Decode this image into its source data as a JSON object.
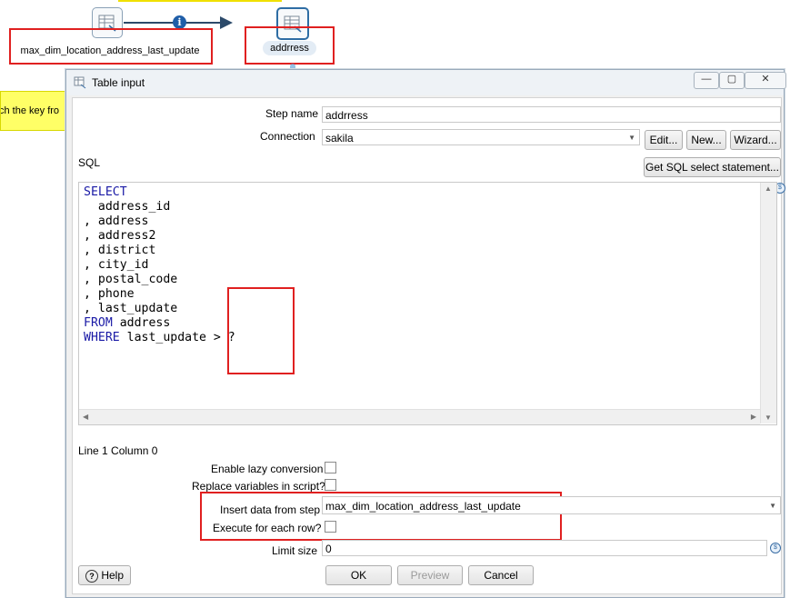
{
  "canvas": {
    "note_text": "ch the key fro",
    "step1_label": "max_dim_location_address_last_update",
    "step2_label": "addrress",
    "hop_info": "i"
  },
  "dialog": {
    "title": "Table input",
    "window_buttons": {
      "minimize": "—",
      "maximize": "▢",
      "close": "✕"
    },
    "step_name_label": "Step name",
    "step_name_value": "addrress",
    "connection_label": "Connection",
    "connection_value": "sakila",
    "edit_button": "Edit...",
    "new_button": "New...",
    "wizard_button": "Wizard...",
    "sql_label": "SQL",
    "get_sql_button": "Get SQL select statement...",
    "sql_lines": [
      {
        "kw": "SELECT",
        "rest": ""
      },
      {
        "kw": "",
        "rest": "  address_id"
      },
      {
        "kw": "",
        "rest": ", address"
      },
      {
        "kw": "",
        "rest": ", address2"
      },
      {
        "kw": "",
        "rest": ", district"
      },
      {
        "kw": "",
        "rest": ", city_id"
      },
      {
        "kw": "",
        "rest": ", postal_code"
      },
      {
        "kw": "",
        "rest": ", phone"
      },
      {
        "kw": "",
        "rest": ", last_update"
      },
      {
        "kw": "FROM",
        "rest": " address"
      },
      {
        "kw": "WHERE",
        "rest": " last_update > ?"
      }
    ],
    "cursor_position": "Line 1 Column 0",
    "lazy_conversion_label": "Enable lazy conversion",
    "replace_variables_label": "Replace variables in script?",
    "insert_data_label": "Insert data from step",
    "insert_data_value": "max_dim_location_address_last_update",
    "execute_each_row_label": "Execute for each row?",
    "limit_size_label": "Limit size",
    "limit_size_value": "0",
    "help_button": "Help",
    "ok_button": "OK",
    "preview_button": "Preview",
    "cancel_button": "Cancel"
  }
}
